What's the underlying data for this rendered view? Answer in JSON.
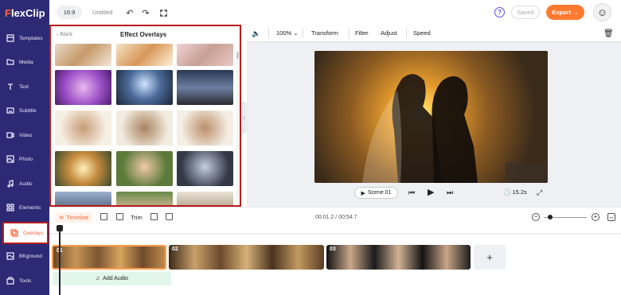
{
  "app": {
    "logo": "FlexClip"
  },
  "sidebar": {
    "items": [
      {
        "label": "Templates"
      },
      {
        "label": "Media"
      },
      {
        "label": "Text"
      },
      {
        "label": "Subtitle"
      },
      {
        "label": "Video"
      },
      {
        "label": "Photo"
      },
      {
        "label": "Audio"
      },
      {
        "label": "Elements"
      },
      {
        "label": "Overlays"
      },
      {
        "label": "BKground"
      },
      {
        "label": "Tools"
      }
    ],
    "active": "Overlays"
  },
  "topbar": {
    "ratio": "16:9",
    "project_title": "Untitled",
    "help": "?",
    "saved_label": "Saved",
    "export_label": "Export →"
  },
  "overlay_panel": {
    "back_label": "Back",
    "title": "Effect Overlays"
  },
  "preview_toolbar": {
    "volume_icon": "speaker-icon",
    "zoom": "100%",
    "tools": [
      "Transform",
      "Filter",
      "Adjust",
      "Speed"
    ]
  },
  "player": {
    "scene_label": "Scene 01",
    "duration": "15.2s"
  },
  "timeline": {
    "tab_label": "Timeline",
    "trim_label": "Trim",
    "time_readout": "00:01.2 / 00:54.7",
    "clips": [
      {
        "label": "01"
      },
      {
        "label": "02"
      },
      {
        "label": "03"
      }
    ],
    "add_audio_label": "Add Audio"
  },
  "colors": {
    "sidebar_bg": "#2c2a75",
    "accent": "#ff7a2f",
    "highlight_border": "#b71c1c"
  }
}
